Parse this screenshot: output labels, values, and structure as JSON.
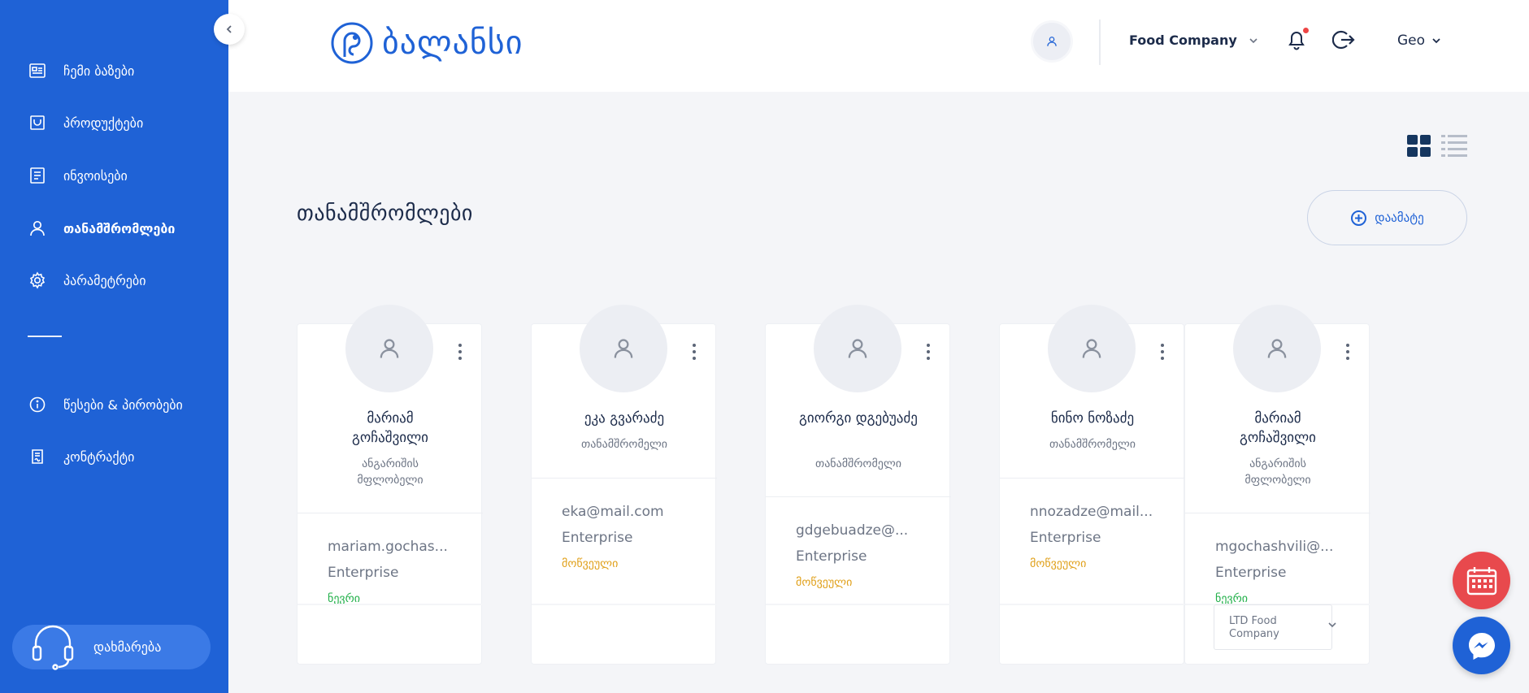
{
  "sidebar": {
    "items": [
      {
        "label": "ჩემი ბაზები",
        "icon": "database-icon"
      },
      {
        "label": "პროდუქტები",
        "icon": "bag-icon"
      },
      {
        "label": "ინვოისები",
        "icon": "invoice-icon"
      },
      {
        "label": "თანამშრომლები",
        "icon": "user-icon",
        "active": true
      },
      {
        "label": "პარამეტრები",
        "icon": "gear-icon"
      },
      {
        "label": "წესები & პირობები",
        "icon": "info-icon"
      },
      {
        "label": "კონტრაქტი",
        "icon": "contract-icon"
      }
    ],
    "help_label": "დახმარება"
  },
  "header": {
    "logo_text": "ბალანსი",
    "company": "Food Company",
    "language": "Geo"
  },
  "main": {
    "title": "თანამშრომლები",
    "add_label": "დაამატე"
  },
  "employees": [
    {
      "name": "მარიამ გოჩაშვილი",
      "role": "ანგარიშის მფლობელი",
      "email": "mariam.gochas...",
      "plan": "Enterprise",
      "status": "ნევრი"
    },
    {
      "name": "ეკა გვარაძე",
      "role": "თანამშრომელი",
      "email": "eka@mail.com",
      "plan": "Enterprise",
      "status": "მოწვეული"
    },
    {
      "name": "გიორგი დგებუაძე",
      "role": "თანამშრომელი",
      "email": "gdgebuadze@...",
      "plan": "Enterprise",
      "status": "მოწვეული"
    },
    {
      "name": "ნინო ნოზაძე",
      "role": "თანამშრომელი",
      "email": "nnozadze@mail...",
      "plan": "Enterprise",
      "status": "მოწვეული"
    },
    {
      "name": "მარიამ გოჩაშვილი",
      "role": "ანგარიშის მფლობელი",
      "email": "mgochashvili@...",
      "plan": "Enterprise",
      "status": "ნევრი"
    }
  ],
  "company_dropdown": {
    "value": "LTD Food Company"
  },
  "colors": {
    "sidebar": "#1f62d6",
    "status_new": "#22b04a",
    "status_invited": "#e0a01a",
    "calendar_fab": "#e8494d"
  }
}
